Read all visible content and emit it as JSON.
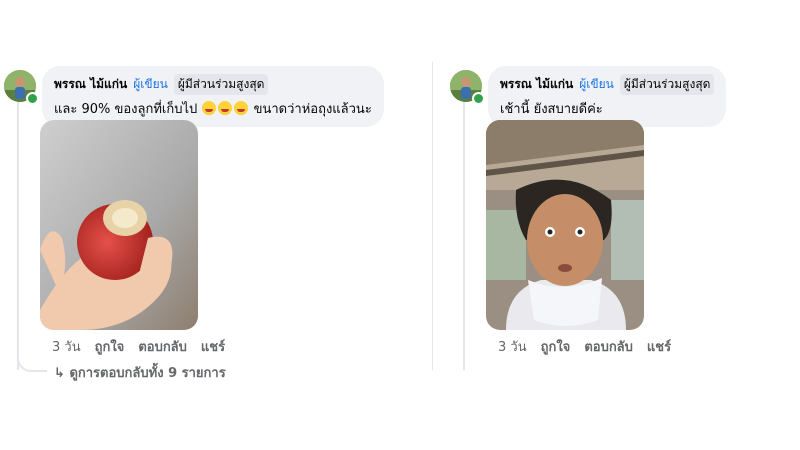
{
  "comments": [
    {
      "author_name": "พรรณ ไม้แก่น",
      "author_tag": "ผู้เขียน",
      "badge": "ผู้มีส่วนร่วมสูงสุด",
      "text_before": "และ 90% ของลูกที่เก็บไป",
      "text_after": "ขนาดว่าห่อถุงแล้วนะ",
      "emoji_names": [
        "rolling-laughing-emoji",
        "rolling-laughing-emoji",
        "rolling-laughing-emoji"
      ],
      "time": "3 วัน",
      "like": "ถูกใจ",
      "reply": "ตอบกลับ",
      "share": "แชร์",
      "view_replies": "ดูการตอบกลับทั้ง 9 รายการ",
      "view_replies_icon": "reply-arrow-icon"
    },
    {
      "author_name": "พรรณ ไม้แก่น",
      "author_tag": "ผู้เขียน",
      "badge": "ผู้มีส่วนร่วมสูงสุด",
      "text": "เช้านี้ ยังสบายดีค่ะ",
      "time": "3 วัน",
      "like": "ถูกใจ",
      "reply": "ตอบกลับ",
      "share": "แชร์"
    }
  ],
  "colors": {
    "bubble_bg": "#f0f2f5",
    "author_tag": "#1b74e4",
    "meta_text": "#65676b",
    "online": "#31a24c"
  }
}
